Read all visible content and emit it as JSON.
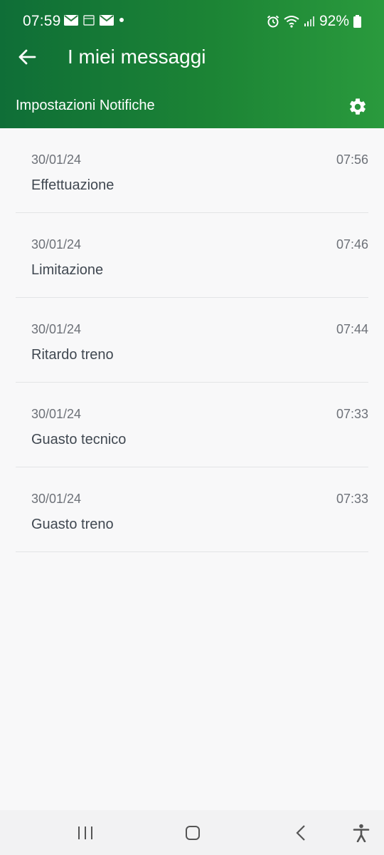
{
  "status_bar": {
    "time": "07:59",
    "battery": "92%",
    "notification_icons": [
      "mail-icon",
      "calendar-icon",
      "mail-icon",
      "dot-icon"
    ],
    "system_icons": [
      "alarm-icon",
      "wifi-icon",
      "signal-icon",
      "battery-icon"
    ]
  },
  "app_bar": {
    "title": "I miei messaggi",
    "back_icon": "arrow-back-icon"
  },
  "settings_row": {
    "label": "Impostazioni Notifiche",
    "icon": "gear-icon"
  },
  "messages": [
    {
      "date": "30/01/24",
      "time": "07:56",
      "title": "Effettuazione"
    },
    {
      "date": "30/01/24",
      "time": "07:46",
      "title": "Limitazione"
    },
    {
      "date": "30/01/24",
      "time": "07:44",
      "title": "Ritardo treno"
    },
    {
      "date": "30/01/24",
      "time": "07:33",
      "title": "Guasto tecnico"
    },
    {
      "date": "30/01/24",
      "time": "07:33",
      "title": "Guasto treno"
    }
  ],
  "nav_bar": {
    "icons": [
      "recent-apps-icon",
      "home-icon",
      "back-icon",
      "accessibility-icon"
    ]
  },
  "colors": {
    "header_start": "#0f6e37",
    "header_end": "#2a9a3d",
    "background": "#f8f8f9",
    "text_primary": "#404851",
    "text_secondary": "#6d7178"
  }
}
